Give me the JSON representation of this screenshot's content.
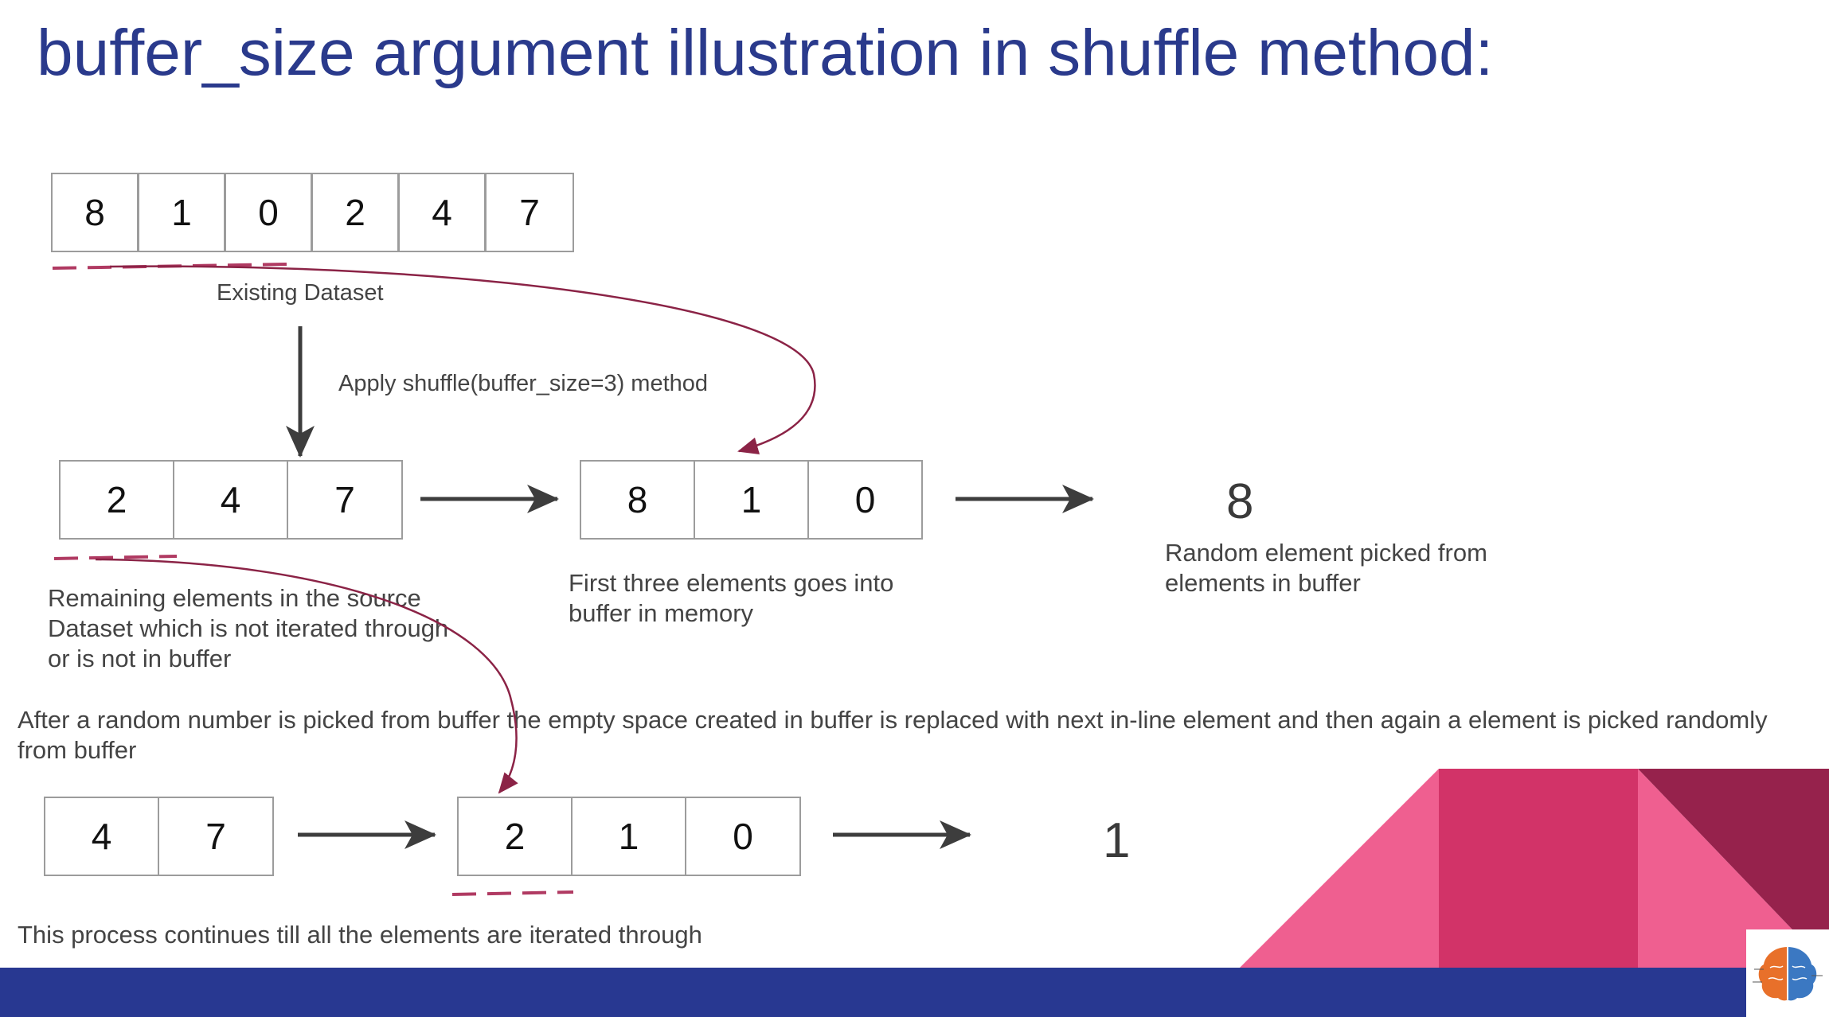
{
  "title": "buffer_size argument illustration in shuffle method:",
  "existing_dataset": {
    "cells": [
      "8",
      "1",
      "0",
      "2",
      "4",
      "7"
    ],
    "label": "Existing Dataset"
  },
  "apply_label": "Apply shuffle(buffer_size=3) method",
  "stage1": {
    "remaining_cells": [
      "2",
      "4",
      "7"
    ],
    "remaining_label": "Remaining elements in the source Dataset which is not iterated through or is not in buffer",
    "buffer_cells": [
      "8",
      "1",
      "0"
    ],
    "buffer_label": "First three elements goes into buffer in memory",
    "picked": "8",
    "picked_label": "Random element picked from elements in buffer"
  },
  "explanation": "After a random number is picked from buffer the empty space created in buffer is replaced with next in-line  element and then again a element is picked randomly from buffer",
  "stage2": {
    "remaining_cells": [
      "4",
      "7"
    ],
    "buffer_cells": [
      "2",
      "1",
      "0"
    ],
    "picked": "1"
  },
  "footer_note": "This process continues till all the elements are iterated through",
  "colors": {
    "title": "#2a3a8c",
    "dash": "#b03a62",
    "curve_arrow": "#8b2346",
    "arrow": "#3d3d3d",
    "bar": "#283891",
    "pink_light": "#ef5f90",
    "pink_mid": "#d23368",
    "maroon": "#96224c"
  },
  "icons": {
    "logo": "brain-logo-icon"
  }
}
